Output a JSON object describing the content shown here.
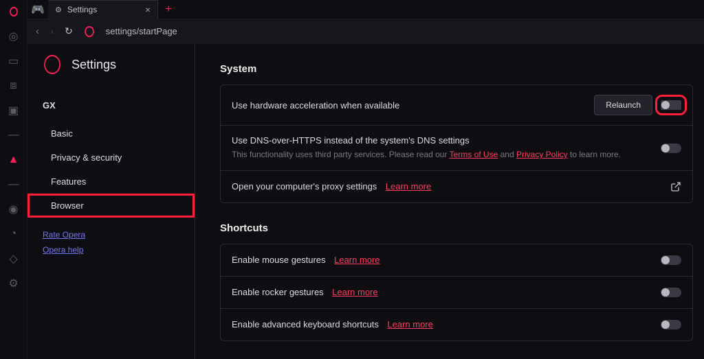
{
  "tab": {
    "title": "Settings"
  },
  "toolbar": {
    "url": "settings/startPage"
  },
  "page": {
    "title": "Settings"
  },
  "sidebar": {
    "group": "GX",
    "items": [
      {
        "label": "Basic"
      },
      {
        "label": "Privacy & security"
      },
      {
        "label": "Features"
      },
      {
        "label": "Browser"
      }
    ],
    "links": [
      {
        "label": "Rate Opera"
      },
      {
        "label": "Opera help"
      }
    ]
  },
  "sections": {
    "system": {
      "title": "System",
      "rows": {
        "hw": {
          "label": "Use hardware acceleration when available",
          "relaunch": "Relaunch"
        },
        "dns": {
          "label": "Use DNS-over-HTTPS instead of the system's DNS settings",
          "desc_prefix": "This functionality uses third party services. Please read our ",
          "terms": "Terms of Use",
          "and": " and ",
          "privacy": "Privacy Policy",
          "desc_suffix": " to learn more."
        },
        "proxy": {
          "label": "Open your computer's proxy settings",
          "learn": "Learn more"
        }
      }
    },
    "shortcuts": {
      "title": "Shortcuts",
      "rows": {
        "mouse": {
          "label": "Enable mouse gestures",
          "learn": "Learn more"
        },
        "rocker": {
          "label": "Enable rocker gestures",
          "learn": "Learn more"
        },
        "keyboard": {
          "label": "Enable advanced keyboard shortcuts",
          "learn": "Learn more"
        }
      }
    }
  }
}
